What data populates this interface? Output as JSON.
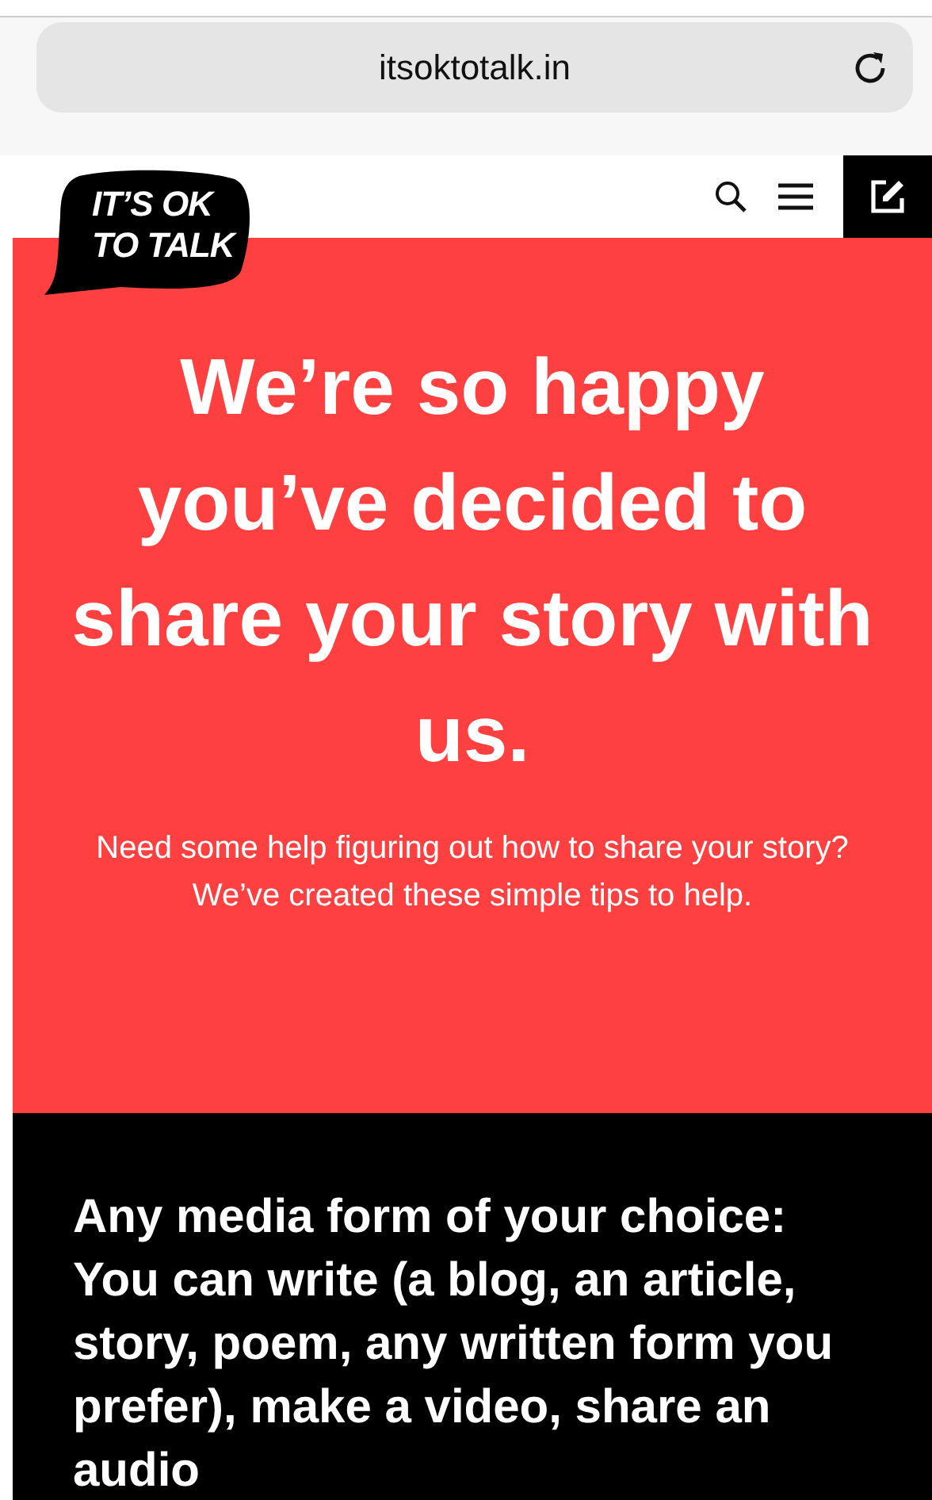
{
  "browser": {
    "url": "itsoktotalk.in"
  },
  "header": {
    "logo": [
      "IT’S OK",
      "TO TALK"
    ]
  },
  "hero": {
    "title": "We’re so happy you’ve decided to share your story with us.",
    "subtitle": "Need some help figuring out how to share your story? We’ve created these simple tips to help."
  },
  "tips": {
    "text": "Any media form of your choice: You can write (a blog, an article, story, poem, any written form you prefer), make a video, share an audio"
  }
}
